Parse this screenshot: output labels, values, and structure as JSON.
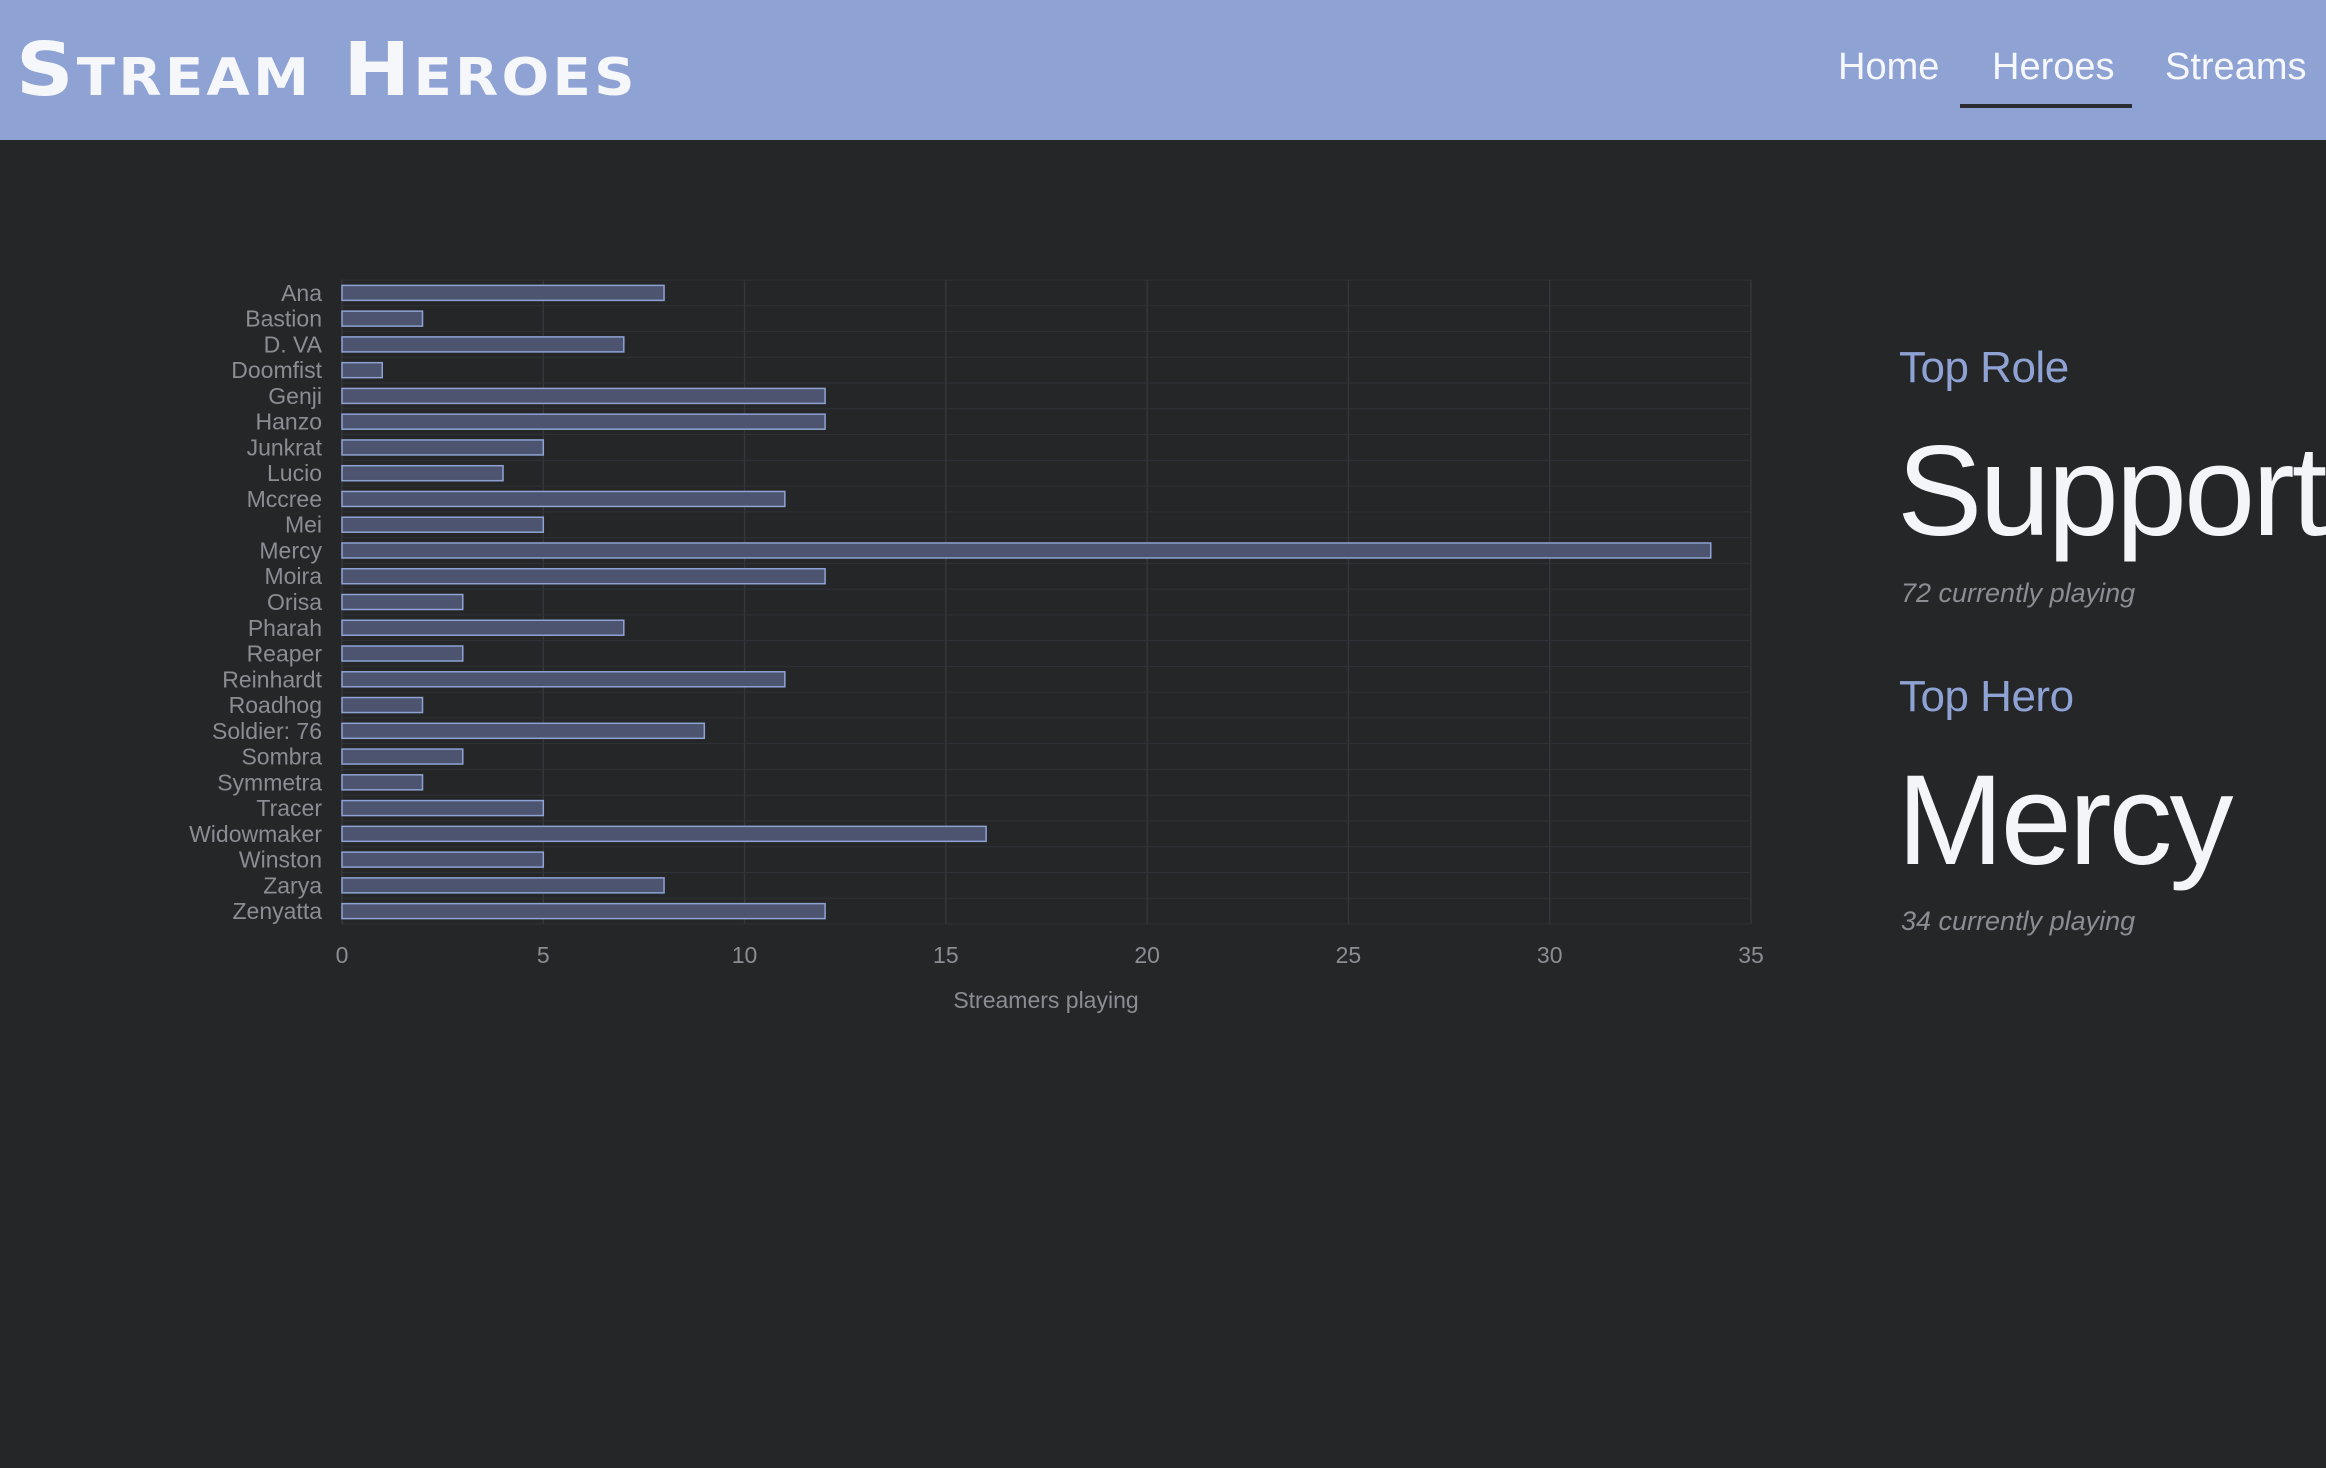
{
  "header": {
    "logo": "Stream Heroes",
    "nav": [
      "Home",
      "Heroes",
      "Streams"
    ],
    "active": "Heroes"
  },
  "colors": {
    "accent": "#8ea2d4",
    "background": "#252628",
    "bar_fill": "#4d5470",
    "bar_stroke": "#8ea2d4"
  },
  "stats": {
    "top_role_label": "Top Role",
    "top_role_value": "Support",
    "top_role_sub": "72 currently playing",
    "top_hero_label": "Top Hero",
    "top_hero_value": "Mercy",
    "top_hero_sub": "34 currently playing"
  },
  "chart_data": {
    "type": "bar",
    "orientation": "horizontal",
    "categories": [
      "Ana",
      "Bastion",
      "D. VA",
      "Doomfist",
      "Genji",
      "Hanzo",
      "Junkrat",
      "Lucio",
      "Mccree",
      "Mei",
      "Mercy",
      "Moira",
      "Orisa",
      "Pharah",
      "Reaper",
      "Reinhardt",
      "Roadhog",
      "Soldier: 76",
      "Sombra",
      "Symmetra",
      "Tracer",
      "Widowmaker",
      "Winston",
      "Zarya",
      "Zenyatta"
    ],
    "values": [
      8,
      2,
      7,
      1,
      12,
      12,
      5,
      4,
      11,
      5,
      34,
      12,
      3,
      7,
      3,
      11,
      2,
      9,
      3,
      2,
      5,
      16,
      5,
      8,
      12
    ],
    "xlabel": "Streamers playing",
    "xlim": [
      0,
      35
    ],
    "xticks": [
      0,
      5,
      10,
      15,
      20,
      25,
      30,
      35
    ],
    "grid": true
  }
}
